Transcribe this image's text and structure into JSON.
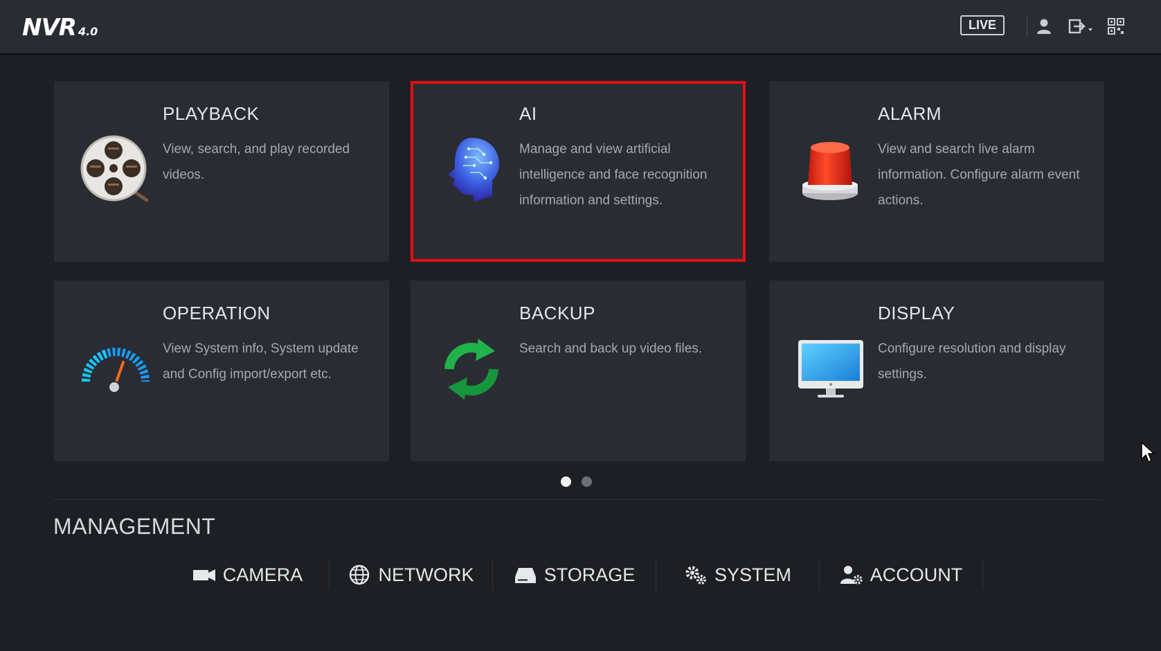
{
  "header": {
    "logo": "NVR",
    "logo_version": "4.0",
    "live_label": "LIVE",
    "icons": [
      "user-icon",
      "logout-icon",
      "qr-code-icon"
    ]
  },
  "tiles": [
    {
      "title": "PLAYBACK",
      "description": "View, search, and play recorded videos.",
      "icon": "film-reel-icon",
      "selected": false
    },
    {
      "title": "AI",
      "description": "Manage and view artificial intelligence and face recognition information and settings.",
      "icon": "ai-head-icon",
      "selected": true
    },
    {
      "title": "ALARM",
      "description": "View and search live alarm information. Configure alarm event actions.",
      "icon": "alarm-light-icon",
      "selected": false
    },
    {
      "title": "OPERATION",
      "description": "View System info, System update and Config import/export etc.",
      "icon": "gauge-icon",
      "selected": false
    },
    {
      "title": "BACKUP",
      "description": "Search and back up video files.",
      "icon": "refresh-icon",
      "selected": false
    },
    {
      "title": "DISPLAY",
      "description": "Configure resolution and display settings.",
      "icon": "monitor-icon",
      "selected": false
    }
  ],
  "pager": {
    "pages": 2,
    "current": 1
  },
  "management": {
    "title": "MANAGEMENT",
    "items": [
      {
        "label": "CAMERA",
        "icon": "camera-icon"
      },
      {
        "label": "NETWORK",
        "icon": "network-globe-icon"
      },
      {
        "label": "STORAGE",
        "icon": "hard-drive-icon"
      },
      {
        "label": "SYSTEM",
        "icon": "gears-icon"
      },
      {
        "label": "ACCOUNT",
        "icon": "account-settings-icon"
      }
    ]
  },
  "colors": {
    "selection_border": "#e01010",
    "tile_bg": "#2a2c33",
    "page_bg": "#1e1f24"
  }
}
